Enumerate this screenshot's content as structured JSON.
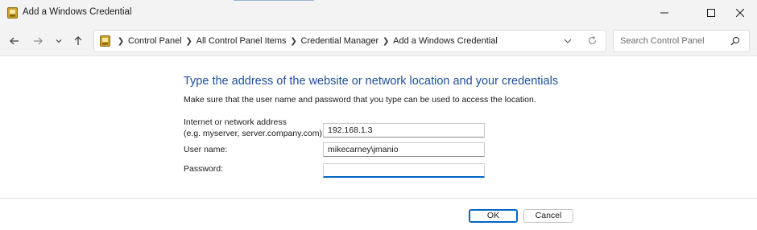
{
  "window": {
    "title": "Add a Windows Credential",
    "icon": "control-panel-icon"
  },
  "titlebar_controls": [
    "minimize-icon",
    "maximize-icon",
    "close-icon"
  ],
  "navigation": {
    "buttons": [
      "back-arrow-icon",
      "forward-arrow-icon",
      "recent-dropdown-icon",
      "up-arrow-icon"
    ],
    "breadcrumb": [
      "Control Panel",
      "All Control Panel Items",
      "Credential Manager",
      "Add a Windows Credential"
    ],
    "search_placeholder": "Search Control Panel"
  },
  "form": {
    "heading": "Type the address of the website or network location and your credentials",
    "description": "Make sure that the user name and password that you type can be used to access the location.",
    "address_label_line1": "Internet or network address",
    "address_label_line2": "(e.g. myserver, server.company.com):",
    "address_value": "192.168.1.3",
    "username_label": "User name:",
    "username_value": "mikecarney\\jmanio",
    "password_label": "Password:",
    "password_value": ""
  },
  "buttons": {
    "ok": "OK",
    "cancel": "Cancel"
  },
  "colors": {
    "heading": "#1e4e9c",
    "accent": "#0067c0",
    "chrome": "#f3f3f3"
  }
}
